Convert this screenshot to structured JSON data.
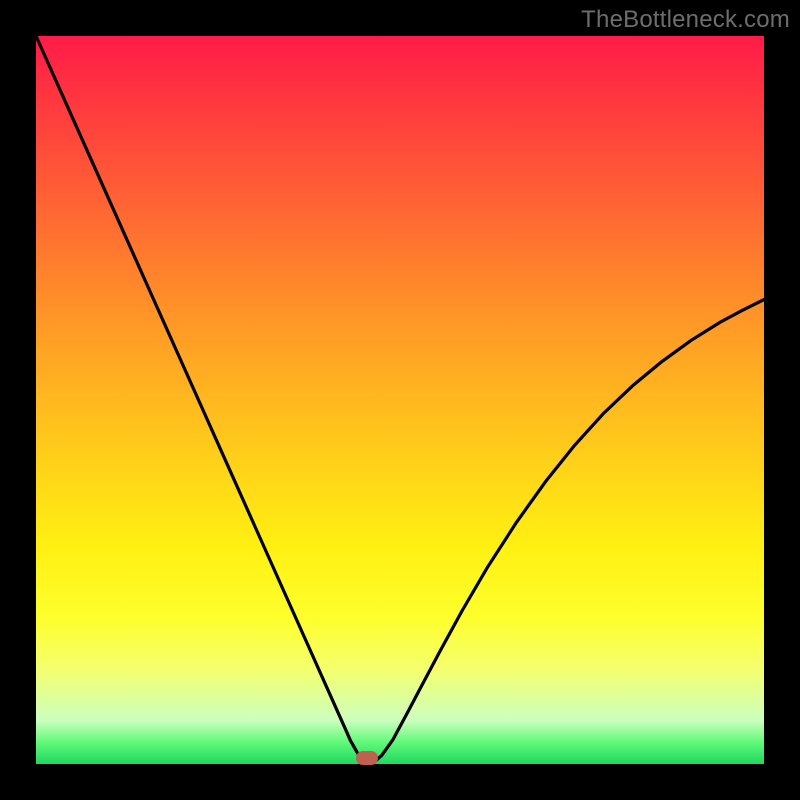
{
  "watermark": "TheBottleneck.com",
  "colors": {
    "frame": "#000000",
    "curve": "#000000",
    "marker": "#c0604e",
    "gradient_top": "#ff1b48",
    "gradient_bottom": "#1dd95e"
  },
  "chart_data": {
    "type": "line",
    "title": "",
    "xlabel": "",
    "ylabel": "",
    "x": [
      0.0,
      0.025,
      0.05,
      0.075,
      0.1,
      0.125,
      0.15,
      0.175,
      0.2,
      0.225,
      0.25,
      0.275,
      0.3,
      0.325,
      0.35,
      0.375,
      0.4,
      0.425,
      0.432,
      0.44,
      0.446,
      0.45,
      0.455,
      0.459,
      0.465,
      0.475,
      0.49,
      0.51,
      0.53,
      0.555,
      0.585,
      0.62,
      0.66,
      0.7,
      0.74,
      0.78,
      0.82,
      0.86,
      0.9,
      0.94,
      0.97,
      1.0
    ],
    "values": [
      1.0,
      0.944,
      0.888,
      0.832,
      0.776,
      0.72,
      0.664,
      0.608,
      0.552,
      0.496,
      0.44,
      0.384,
      0.328,
      0.272,
      0.216,
      0.16,
      0.104,
      0.048,
      0.032,
      0.018,
      0.008,
      0.003,
      0.0,
      0.0,
      0.003,
      0.012,
      0.033,
      0.07,
      0.108,
      0.155,
      0.21,
      0.27,
      0.332,
      0.388,
      0.438,
      0.482,
      0.52,
      0.553,
      0.582,
      0.607,
      0.623,
      0.638
    ],
    "xlim": [
      0,
      1
    ],
    "ylim": [
      0,
      1
    ],
    "marker": {
      "x": 0.455,
      "y": 0.008
    },
    "grid": false,
    "legend": false
  }
}
